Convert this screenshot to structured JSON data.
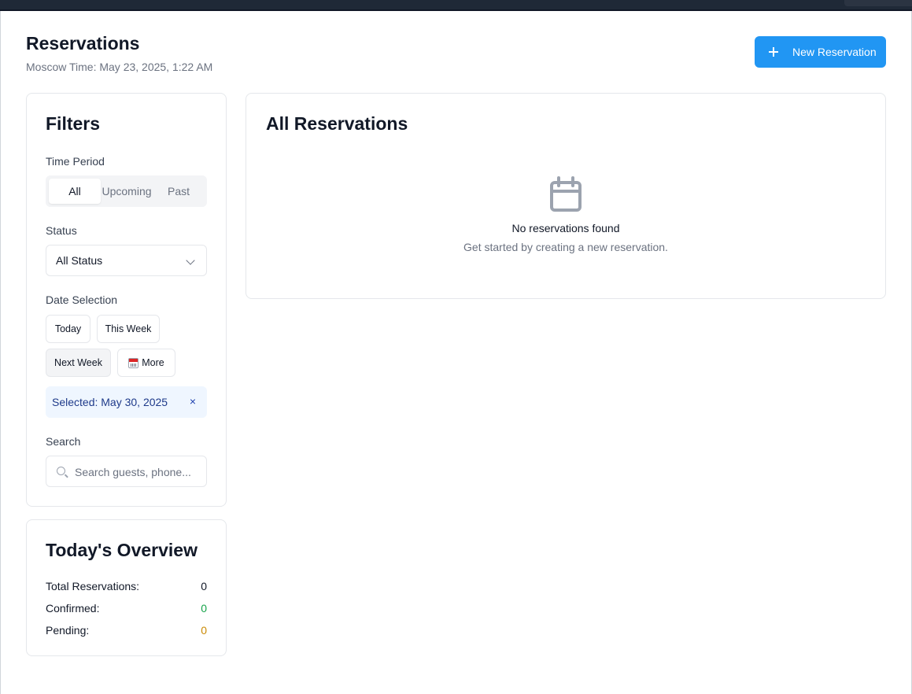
{
  "header": {
    "title": "Reservations",
    "subtitle": "Moscow Time: May 23, 2025, 1:22 AM",
    "new_button_label": "New Reservation"
  },
  "filters": {
    "title": "Filters",
    "time_period": {
      "label": "Time Period",
      "options": [
        "All",
        "Upcoming",
        "Past"
      ],
      "selected": "All"
    },
    "status": {
      "label": "Status",
      "value": "All Status"
    },
    "date_selection": {
      "label": "Date Selection",
      "buttons": [
        "Today",
        "This Week",
        "Next Week",
        "More"
      ],
      "active": "Next Week",
      "selected_text": "Selected: May 30, 2025",
      "clear_symbol": "×"
    },
    "search": {
      "label": "Search",
      "placeholder": "Search guests, phone..."
    }
  },
  "overview": {
    "title": "Today's Overview",
    "rows": [
      {
        "label": "Total Reservations:",
        "value": "0",
        "color": "#111827"
      },
      {
        "label": "Confirmed:",
        "value": "0",
        "color": "#16a34a"
      },
      {
        "label": "Pending:",
        "value": "0",
        "color": "#ca8a04"
      }
    ]
  },
  "main": {
    "title": "All Reservations",
    "empty_icon": "calendar-icon",
    "empty_title": "No reservations found",
    "empty_subtitle": "Get started by creating a new reservation."
  },
  "colors": {
    "primary": "#2196f3",
    "confirmed": "#16a34a",
    "pending": "#ca8a04"
  }
}
